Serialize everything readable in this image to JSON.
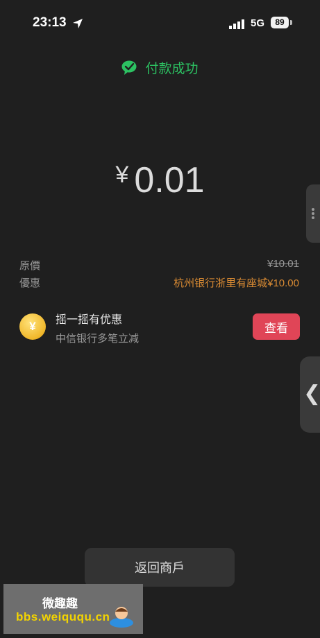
{
  "status_bar": {
    "time": "23:13",
    "network": "5G",
    "battery": "89",
    "colors": {
      "text": "#ffffff"
    }
  },
  "header": {
    "success_text": "付款成功",
    "icon": "wechat-pay-icon",
    "color": "#2cc262"
  },
  "payment": {
    "currency": "¥",
    "amount": "0.01"
  },
  "details": {
    "original_label": "原價",
    "original_value": "¥10.01",
    "discount_label": "優惠",
    "discount_value": "杭州银行浙里有座城¥10.00"
  },
  "promo": {
    "title": "摇一摇有优惠",
    "subtitle": "中信银行多笔立减",
    "button_label": "查看",
    "icon": "coin-icon",
    "button_color": "#e04557"
  },
  "footer": {
    "return_label": "返回商戶"
  },
  "watermark": {
    "title": "微趣趣",
    "url": "bbs.weiququ.cn"
  }
}
